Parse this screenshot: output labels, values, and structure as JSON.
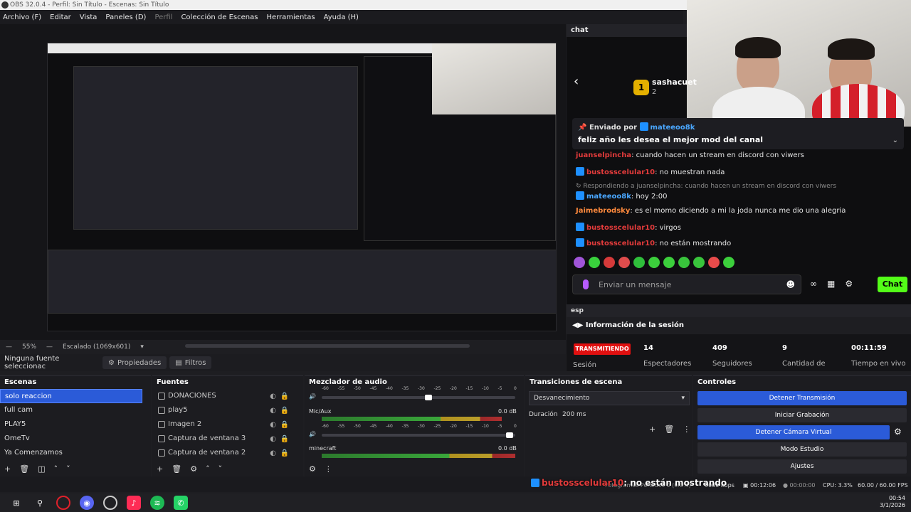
{
  "window": {
    "title": "OBS 32.0.4 - Perfil: Sin Título - Escenas: Sin Título"
  },
  "menu": [
    {
      "label": "Archivo (F)",
      "dim": false
    },
    {
      "label": "Editar",
      "dim": false
    },
    {
      "label": "Vista",
      "dim": false
    },
    {
      "label": "Paneles (D)",
      "dim": false
    },
    {
      "label": "Perfil",
      "dim": true
    },
    {
      "label": "Colección de Escenas",
      "dim": false
    },
    {
      "label": "Herramientas",
      "dim": false
    },
    {
      "label": "Ayuda (H)",
      "dim": false
    }
  ],
  "preview": {
    "zoom": "55%",
    "scale": "Escalado (1069x601)"
  },
  "properties_bar": {
    "no_source": "Ninguna fuente seleccionac",
    "properties": "Propiedades",
    "filters": "Filtros"
  },
  "chat": {
    "header": "chat",
    "badge_number": "1",
    "badge_name": "sashacuet",
    "badge_sub": "2",
    "pinned_by_label": "Enviado por",
    "pinned_by_user": "mateeoo8k",
    "pinned_message": "feliz año les desea el mejor mod del canal",
    "lines": [
      {
        "user": "juanselpincha",
        "text": ": cuando hacen un stream en discord con viwers",
        "color": "uname-red",
        "kick": false
      },
      {
        "user": "bustosscelular10",
        "text": ": no muestran nada",
        "color": "uname-red",
        "kick": true
      },
      {
        "user": "",
        "text": "Respondiendo a juanselpincha: cuando hacen un stream en discord con viwers",
        "color": "reply",
        "kick": false
      },
      {
        "user": "mateeoo8k",
        "text": ": hoy 2:00",
        "color": "uname-blue",
        "kick": true
      },
      {
        "user": "Jaimebrodsky",
        "text": ": es el momo diciendo a mi la joda nunca me dio una alegria",
        "color": "uname-orange",
        "kick": false
      },
      {
        "user": "bustosscelular10",
        "text": ": virgos",
        "color": "uname-red",
        "kick": true
      },
      {
        "user": "bustosscelular10",
        "text": ": no están mostrando",
        "color": "uname-red",
        "kick": true
      }
    ],
    "emote_colors": [
      "#a055d8",
      "#39d13c",
      "#d63a3a",
      "#e04c4c",
      "#2fbf3b",
      "#3ccf3c",
      "#3ccf3c",
      "#39c43c",
      "#39c43c",
      "#e84b4b",
      "#3ccf3c"
    ],
    "input_placeholder": "Enviar un mensaje",
    "send_label": "Chat"
  },
  "session": {
    "header": "esp",
    "title": "Información de la sesión",
    "live": "TRANSMITIENDO",
    "live_label": "Sesión",
    "stats": [
      {
        "value": "14",
        "label": "Espectadores"
      },
      {
        "value": "409",
        "label": "Seguidores"
      },
      {
        "value": "9",
        "label": "Cantidad de"
      },
      {
        "value": "00:11:59",
        "label": "Tiempo en vivo"
      }
    ]
  },
  "scenes": {
    "title": "Escenas",
    "items": [
      "solo reaccion",
      "full cam",
      "PLAY5",
      "OmeTv",
      "Ya Comenzamos"
    ],
    "selected": 0
  },
  "sources": {
    "title": "Fuentes",
    "items": [
      "DONACIONES",
      "play5",
      "Imagen 2",
      "Captura de ventana 3",
      "Captura de ventana 2"
    ]
  },
  "mixer": {
    "title": "Mezclador de audio",
    "scale": [
      "-60",
      "-55",
      "-50",
      "-45",
      "-40",
      "-35",
      "-30",
      "-25",
      "-20",
      "-15",
      "-10",
      "-5",
      "0"
    ],
    "channels": [
      {
        "name": "Mic/Aux",
        "db": "0.0 dB",
        "level": 0.93
      },
      {
        "name": "minecraft",
        "db": "0.0 dB",
        "level": 1.0
      }
    ],
    "master_level": 0.55
  },
  "transitions": {
    "title": "Transiciones de escena",
    "selected": "Desvanecimiento",
    "duration_label": "Duración",
    "duration_value": "200 ms"
  },
  "controls": {
    "title": "Controles",
    "buttons": [
      {
        "label": "Detener Transmisión",
        "blue": true
      },
      {
        "label": "Iniciar Grabación",
        "blue": false
      },
      {
        "label": "Detener Cámara Virtual",
        "blue": true
      },
      {
        "label": "Modo Estudio",
        "blue": false
      },
      {
        "label": "Ajustes",
        "blue": false
      }
    ]
  },
  "status": {
    "overlay_user": "bustosscelular10",
    "overlay_text": ": no están mostrando",
    "frames": "Fotogramas Perdidos 0 (0.0%)",
    "kbps": "5000 kbps",
    "stream_time": "00:12:06",
    "rec_time": "00:00:00",
    "cpu": "CPU: 3.3%",
    "fps": "60.00 / 60.00 FPS"
  },
  "taskbar": {
    "time": "00:54",
    "date": "3/1/2026"
  }
}
